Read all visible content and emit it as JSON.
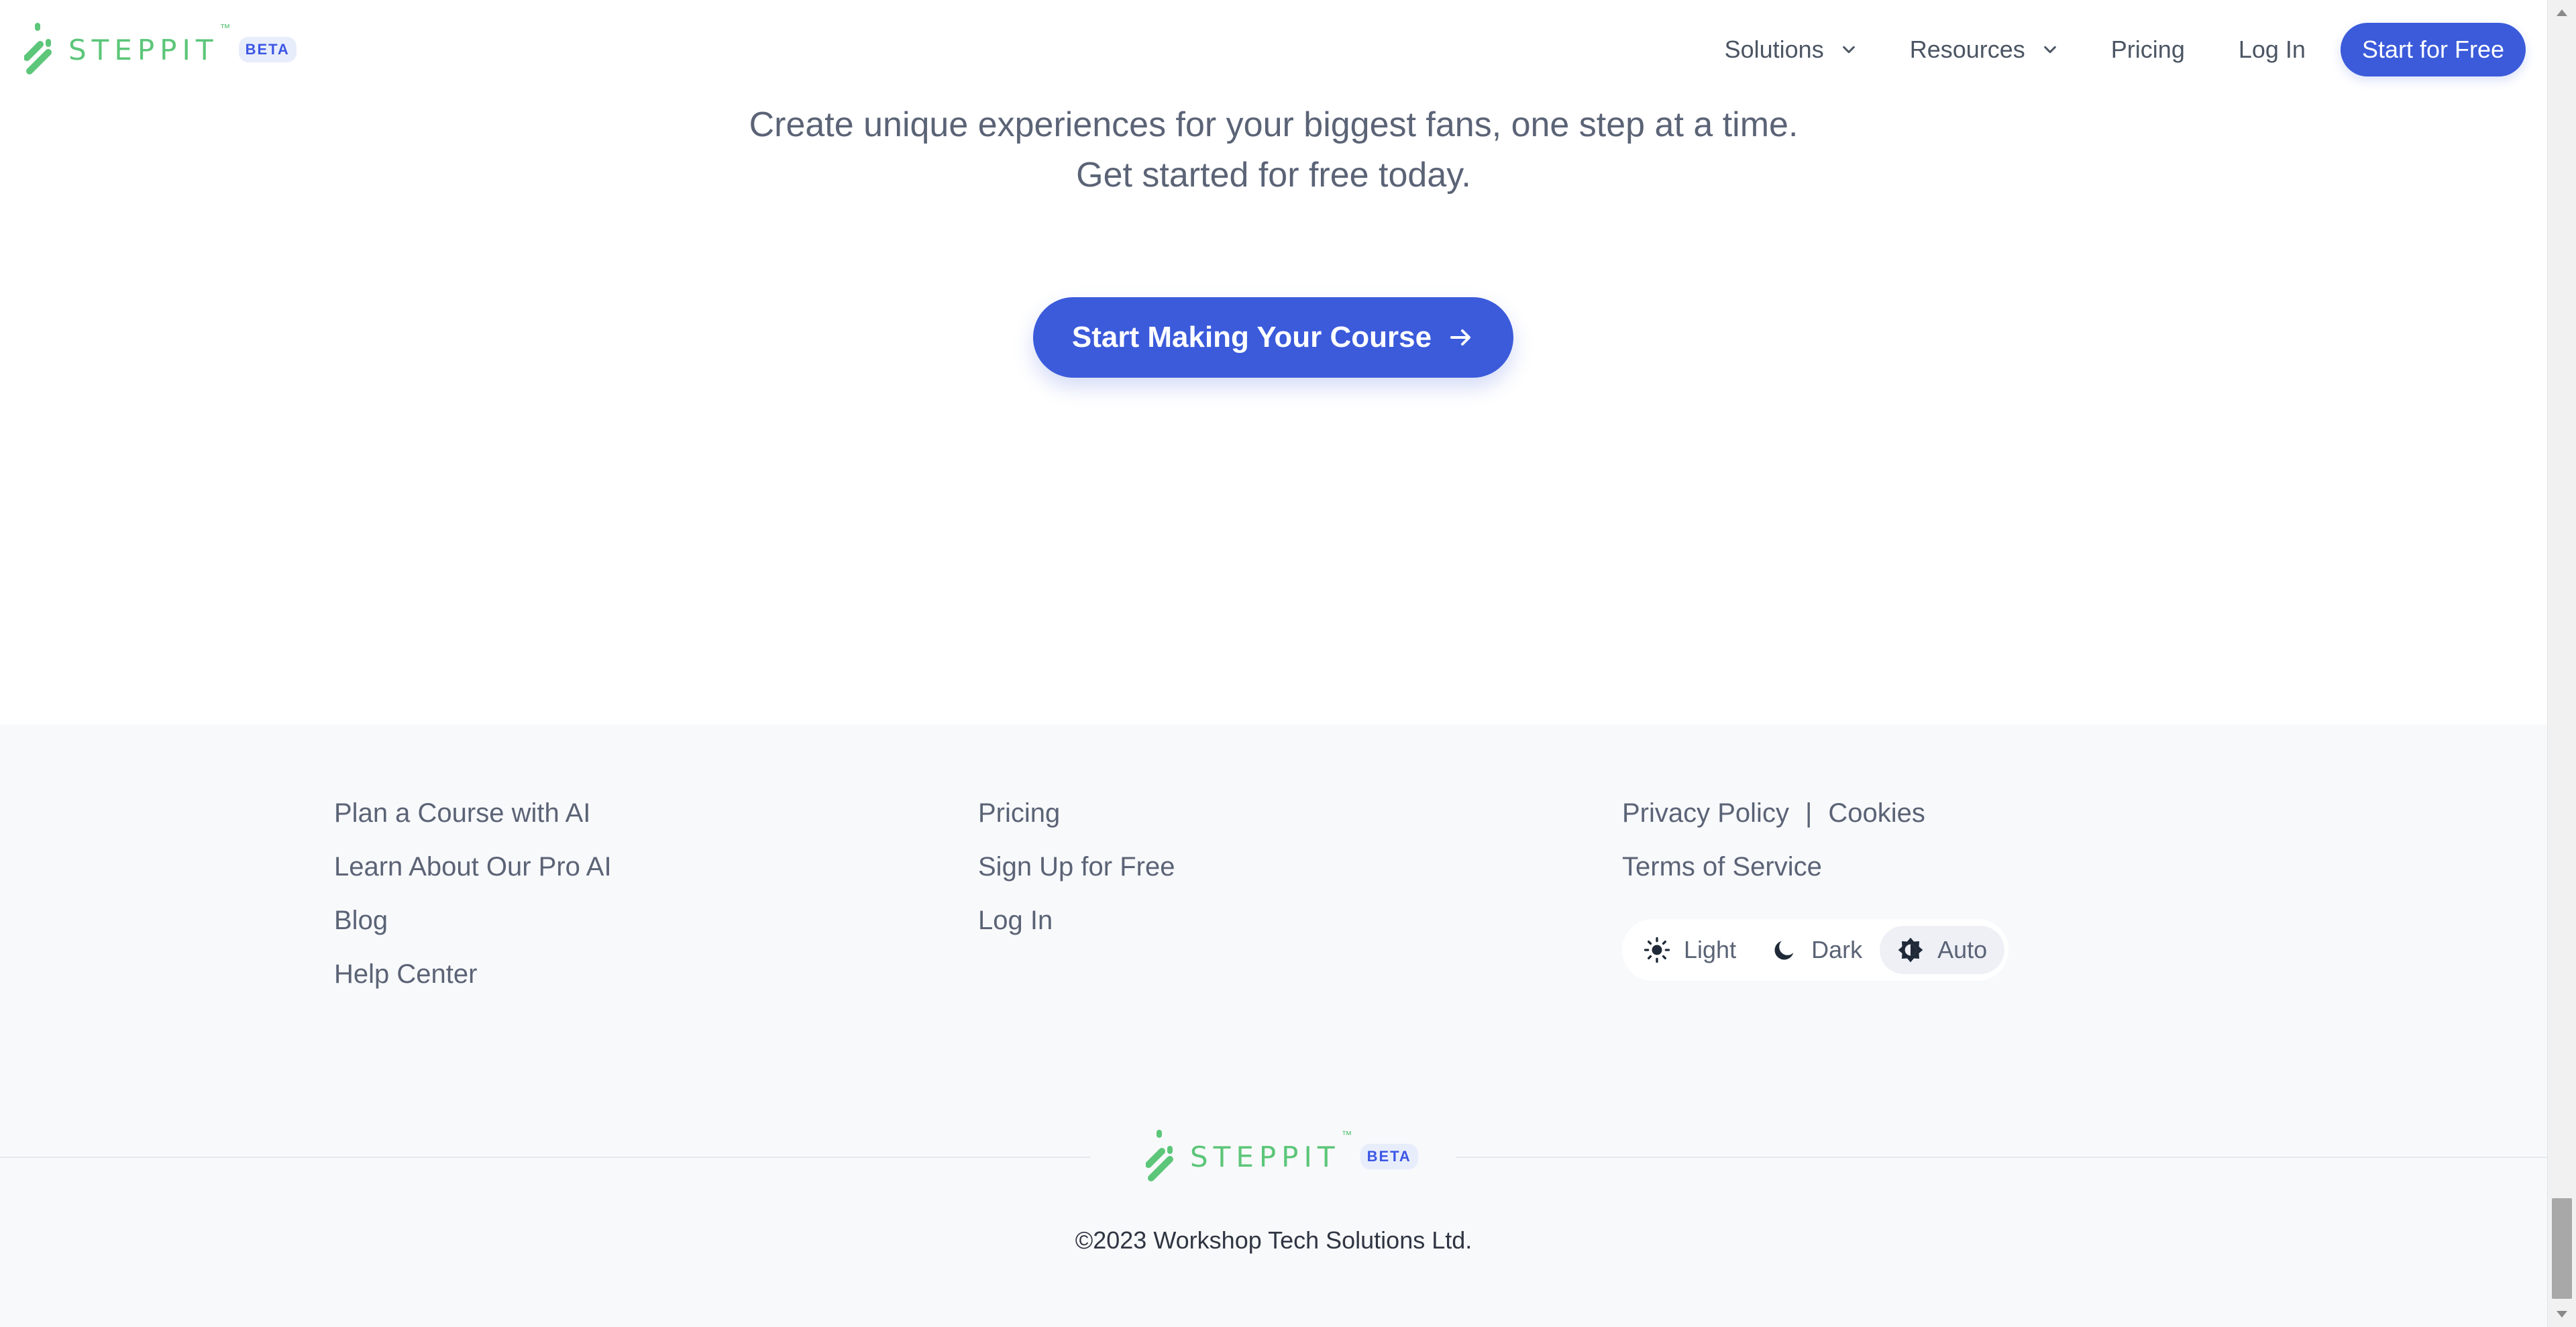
{
  "brand": {
    "name": "STEPPIT",
    "trademark": "™",
    "badge": "BETA",
    "accent_color": "#5cc679",
    "primary_color": "#3b5bdb"
  },
  "header": {
    "nav": [
      {
        "label": "Solutions",
        "has_dropdown": true
      },
      {
        "label": "Resources",
        "has_dropdown": true
      },
      {
        "label": "Pricing",
        "has_dropdown": false
      },
      {
        "label": "Log In",
        "has_dropdown": false
      }
    ],
    "cta_label": "Start for Free"
  },
  "hero": {
    "line1": "Create unique experiences for your biggest fans, one step at a time.",
    "line2": "Get started for free today.",
    "cta_label": "Start Making Your Course",
    "cta_icon": "arrow-right-icon"
  },
  "footer": {
    "col1": [
      "Plan a Course with AI",
      "Learn About Our Pro AI",
      "Blog",
      "Help Center"
    ],
    "col2": [
      "Pricing",
      "Sign Up for Free",
      "Log In"
    ],
    "legal": {
      "privacy": "Privacy Policy",
      "separator": "|",
      "cookies": "Cookies",
      "terms": "Terms of Service"
    },
    "theme": {
      "options": [
        {
          "label": "Light",
          "icon": "sun-icon"
        },
        {
          "label": "Dark",
          "icon": "moon-icon"
        },
        {
          "label": "Auto",
          "icon": "auto-brightness-icon"
        }
      ],
      "selected": "Auto"
    },
    "copyright": "©2023 Workshop Tech Solutions Ltd."
  }
}
